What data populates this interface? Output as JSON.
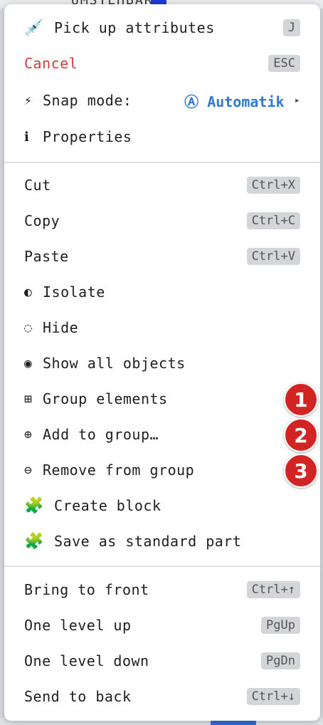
{
  "backdrop": {
    "top_text": "UMSTEHBAR"
  },
  "menu": {
    "top": [
      {
        "icon": "💉",
        "label": "Pick up attributes",
        "shortcut": "J"
      },
      {
        "label": "Cancel",
        "shortcut": "ESC"
      },
      {
        "icon": "⚡",
        "label": "Snap mode:",
        "value_icon": "Ⓐ",
        "value": "Automatik",
        "arrow": "▸"
      },
      {
        "icon": "ℹ",
        "label": "Properties"
      }
    ],
    "edit": [
      {
        "label": "Cut",
        "shortcut": "Ctrl+X"
      },
      {
        "label": "Copy",
        "shortcut": "Ctrl+C"
      },
      {
        "label": "Paste",
        "shortcut": "Ctrl+V"
      },
      {
        "icon": "◐",
        "label": "Isolate"
      },
      {
        "icon": "◌",
        "label": "Hide"
      },
      {
        "icon": "◉",
        "label": "Show all objects"
      },
      {
        "icon": "⊞",
        "label": "Group elements"
      },
      {
        "icon": "⊕",
        "label": "Add to group…"
      },
      {
        "icon": "⊖",
        "label": "Remove from group"
      },
      {
        "icon": "🧩",
        "label": "Create block"
      },
      {
        "icon": "🧩",
        "label": "Save as standard part"
      }
    ],
    "order": [
      {
        "label": "Bring to front",
        "shortcut": "Ctrl+↑"
      },
      {
        "label": "One level up",
        "shortcut": "PgUp"
      },
      {
        "label": "One level down",
        "shortcut": "PgDn"
      },
      {
        "label": "Send to back",
        "shortcut": "Ctrl+↓"
      }
    ]
  },
  "badges": [
    "1",
    "2",
    "3"
  ],
  "colors": {
    "danger": "#d93a3a",
    "accent": "#2f7bd3",
    "badge": "#d32424"
  }
}
